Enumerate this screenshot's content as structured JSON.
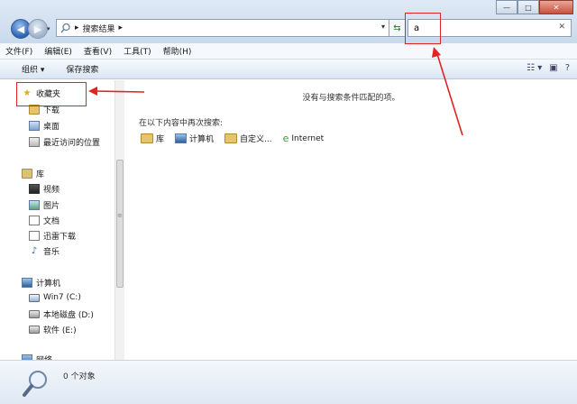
{
  "window": {
    "controls": {
      "minimize": "—",
      "maximize": "□",
      "close": "✕"
    }
  },
  "address": {
    "back_glyph": "◀",
    "forward_glyph": "▶",
    "history_glyph": "▾",
    "path": [
      "搜索结果"
    ],
    "separator": "▸",
    "dropdown_glyph": "▾",
    "refresh_glyph": "⇆"
  },
  "search": {
    "value": "a",
    "clear_glyph": "✕"
  },
  "menu": [
    {
      "label": "文件(F)"
    },
    {
      "label": "编辑(E)"
    },
    {
      "label": "查看(V)"
    },
    {
      "label": "工具(T)"
    },
    {
      "label": "帮助(H)"
    }
  ],
  "commands": {
    "organize": "组织 ▾",
    "save_search": "保存搜索",
    "views_glyph": "☷ ▾",
    "preview_glyph": "▣",
    "help_glyph": "?"
  },
  "nav": {
    "favorites": "收藏夹",
    "downloads": "下载",
    "desktop": "桌面",
    "recent": "最近访问的位置",
    "library": "库",
    "videos": "视频",
    "pictures": "图片",
    "documents": "文档",
    "thunder": "迅雷下载",
    "music": "音乐",
    "computer": "计算机",
    "drive_c": "Win7 (C:)",
    "drive_d": "本地磁盘 (D:)",
    "drive_e": "软件 (E:)",
    "network": "网络"
  },
  "content": {
    "no_results": "没有与搜索条件匹配的项。",
    "search_again_label": "在以下内容中再次搜索:",
    "search_again": [
      {
        "label": "库"
      },
      {
        "label": "计算机"
      },
      {
        "label": "自定义..."
      },
      {
        "label": "Internet"
      }
    ]
  },
  "details": {
    "count": "0 个对象"
  },
  "colors": {
    "annotation": "#e02424",
    "accent": "#2a61b2"
  }
}
